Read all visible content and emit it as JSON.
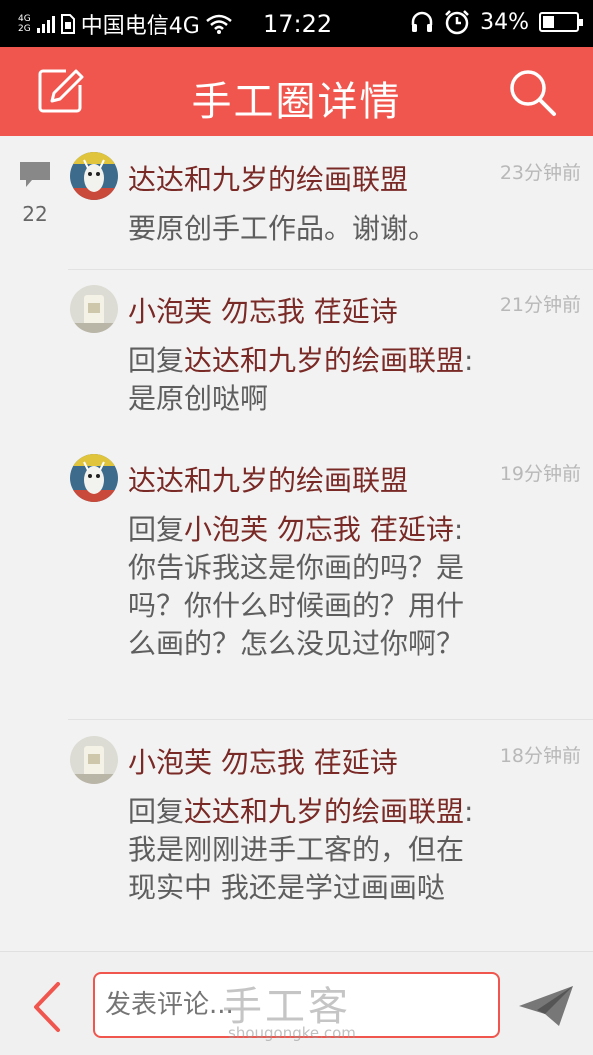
{
  "status_bar": {
    "network_top": "4G",
    "network_bottom": "2G",
    "carrier": "中国电信4G",
    "time": "17:22",
    "battery": "34%",
    "battery_level": 0.34
  },
  "header": {
    "title": "手工圈详情",
    "edit_icon": "edit-icon",
    "search_icon": "search-icon"
  },
  "comment_count": "22",
  "posts": [
    {
      "user": "达达和九岁的绘画联盟",
      "time": "23分钟前",
      "reply_prefix": "",
      "reply_to": "",
      "text": "要原创手工作品。谢谢。"
    },
    {
      "user": "小泡芙  勿忘我 荏延诗",
      "time": "21分钟前",
      "reply_prefix": "回复",
      "reply_to": "达达和九岁的绘画联盟",
      "text": ": 是原创哒啊"
    },
    {
      "user": "达达和九岁的绘画联盟",
      "time": "19分钟前",
      "reply_prefix": "回复",
      "reply_to": "小泡芙  勿忘我 荏延诗",
      "text": ": 你告诉我这是你画的吗？是吗？你什么时候画的？用什么画的？怎么没见过你啊？"
    },
    {
      "user": "小泡芙  勿忘我 荏延诗",
      "time": "18分钟前",
      "reply_prefix": "回复",
      "reply_to": "达达和九岁的绘画联盟",
      "text": ": 我是刚刚进手工客的，但在现实中 我还是学过画画哒"
    }
  ],
  "input": {
    "placeholder": "发表评论..."
  },
  "watermark": {
    "main": "手工客",
    "sub": "shougongke.com"
  },
  "colors": {
    "accent": "#f0564d",
    "username": "#7a2a26"
  }
}
